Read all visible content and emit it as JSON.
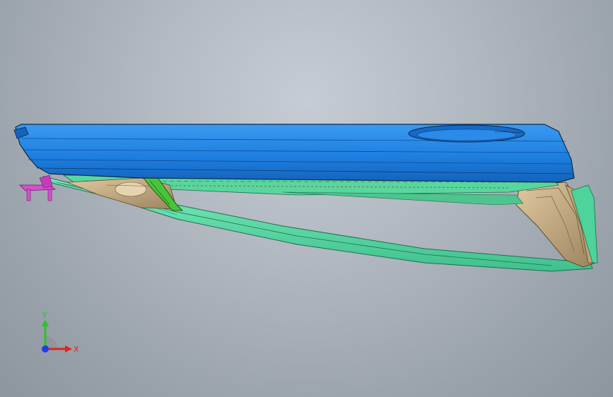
{
  "viewport": {
    "background_top": "#c6ccd3",
    "background_bottom": "#8d959e"
  },
  "model": {
    "colors": {
      "outer_panel": "#1e7fe0",
      "outer_panel_light": "#3b9af0",
      "outer_panel_dark": "#1363bb",
      "frame": "#5fe3ad",
      "frame_dark": "#2fae7c",
      "inner_tan": "#c9ae84",
      "inner_tan_dark": "#9c8460",
      "bracket_green": "#49c43a",
      "hinge_magenta": "#d84fd0",
      "edge": "#0d2a4a"
    }
  },
  "triad": {
    "x_label": "X",
    "y_label": "Y",
    "x_color": "#e0241f",
    "y_color": "#2fbf2f",
    "z_color": "#1f3fe0"
  }
}
